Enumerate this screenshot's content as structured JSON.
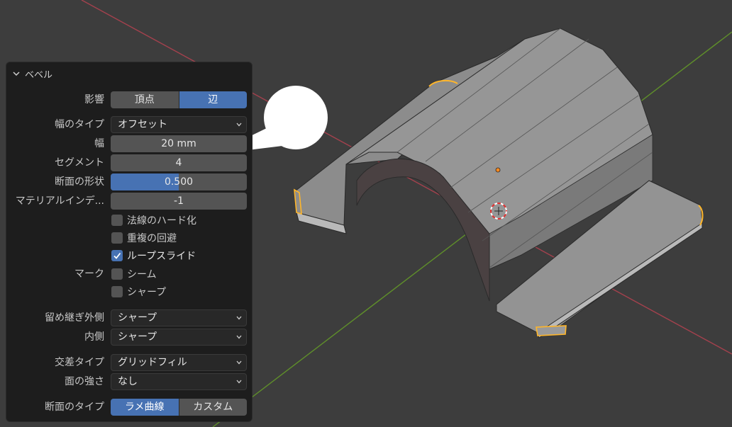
{
  "panel": {
    "title": "ベベル",
    "affect": {
      "label": "影響",
      "options": [
        "頂点",
        "辺"
      ],
      "selected": 1
    },
    "width_type": {
      "label": "幅のタイプ",
      "value": "オフセット"
    },
    "width": {
      "label": "幅",
      "value": "20 mm"
    },
    "segments": {
      "label": "セグメント",
      "value": "4"
    },
    "shape": {
      "label": "断面の形状",
      "value": "0.500",
      "fraction": 0.5
    },
    "material_index": {
      "label": "マテリアルインデ...",
      "value": "-1"
    },
    "checkboxes": [
      {
        "label": "法線のハード化",
        "checked": false
      },
      {
        "label": "重複の回避",
        "checked": false
      },
      {
        "label": "ループスライド",
        "checked": true
      }
    ],
    "mark": {
      "label": "マーク",
      "items": [
        {
          "label": "シーム",
          "checked": false
        },
        {
          "label": "シャープ",
          "checked": false
        }
      ]
    },
    "miter_outer": {
      "label": "留め継ぎ外側",
      "value": "シャープ"
    },
    "miter_inner": {
      "label": "内側",
      "value": "シャープ"
    },
    "intersection_type": {
      "label": "交差タイプ",
      "value": "グリッドフィル"
    },
    "face_strength": {
      "label": "面の強さ",
      "value": "なし"
    },
    "profile_type": {
      "label": "断面のタイプ",
      "options": [
        "ラメ曲線",
        "カスタム"
      ],
      "selected": 0
    }
  },
  "colors": {
    "accent": "#4772b3",
    "viewport_bg": "#3d3d3d",
    "x_axis": "#a3414d",
    "y_axis": "#5f8f2a",
    "selection": "#ffb62a"
  }
}
